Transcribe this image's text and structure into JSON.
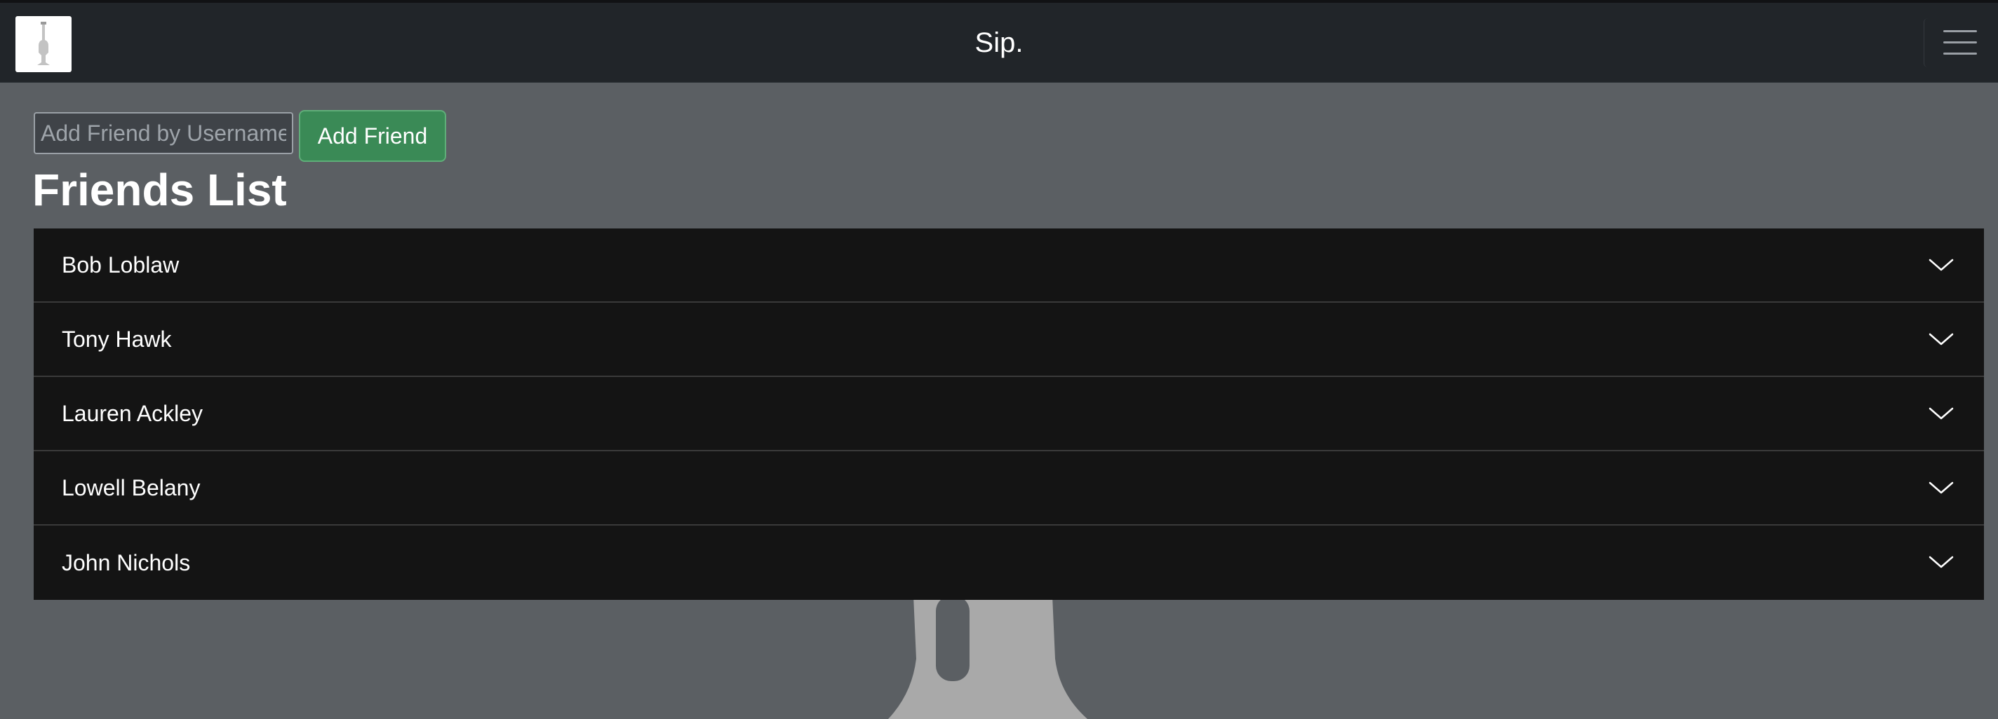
{
  "navbar": {
    "brand": "Sip.",
    "logo_icon": "wine-glass-logo-icon",
    "menu_icon": "hamburger-menu-icon"
  },
  "add_friend": {
    "placeholder": "Add Friend by Username",
    "value": "",
    "button_label": "Add Friend"
  },
  "friends": {
    "title": "Friends List",
    "items": [
      {
        "name": "Bob Loblaw",
        "icon": "chevron-down-icon"
      },
      {
        "name": "Tony Hawk",
        "icon": "chevron-down-icon"
      },
      {
        "name": "Lauren Ackley",
        "icon": "chevron-down-icon"
      },
      {
        "name": "Lowell Belany",
        "icon": "chevron-down-icon"
      },
      {
        "name": "John Nichols",
        "icon": "chevron-down-icon"
      }
    ]
  },
  "colors": {
    "navbar_bg": "#212529",
    "page_bg": "#5b5f63",
    "accordion_bg": "#141414",
    "button_green": "#3a8a56"
  }
}
